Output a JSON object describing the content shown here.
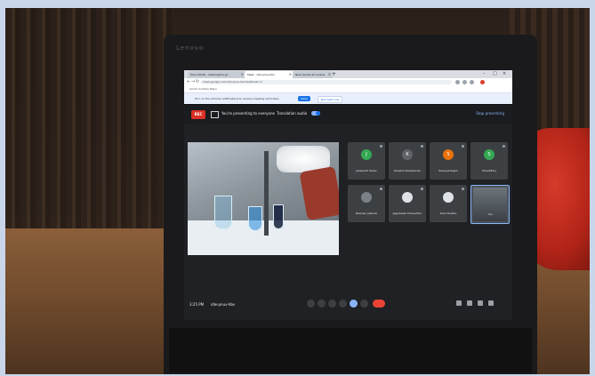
{
  "laptop": {
    "brand": "Lenovo"
  },
  "browser": {
    "tabs": [
      {
        "label": "Plus (2018) - shakira@lcs.gc"
      },
      {
        "label": "Meet - ofw-pnuv-hbv"
      },
      {
        "label": "New results at oceans"
      }
    ],
    "url": "meet.google.com/ofw-pnuv-hbv?authuser=1",
    "bookmarks": "Gmail  YouTube  Maps",
    "notice": {
      "text": "Turn on the Chrome notifications to receive meeting reminders",
      "primary_label": "Allow",
      "secondary_label": "Not right now"
    }
  },
  "meet": {
    "record_label": "REC",
    "presenting_text": "You're presenting to everyone",
    "translation_label": "Translation audio",
    "stop_label": "Stop presenting",
    "time": "3:25 PM",
    "meeting_code": "ofw-pnuv-hbv",
    "participants": [
      {
        "initial": "J",
        "name": "Jaswanth Yadav",
        "color": "#34a853"
      },
      {
        "initial": "K",
        "name": "Kaushal Deshpande",
        "color": "#5f6368"
      },
      {
        "initial": "S",
        "name": "Saranya Rajan",
        "color": "#e8710a"
      },
      {
        "initial": "S",
        "name": "Shraddha J",
        "color": "#34a853"
      },
      {
        "initial": "",
        "name": "Rahman Jalal Ali",
        "color": "#3c4043"
      },
      {
        "initial": "",
        "name": "Jagadeesh Pranavithu",
        "color": "#3c4043"
      },
      {
        "initial": "",
        "name": "Sunil Prabhu",
        "color": "#3c4043"
      },
      {
        "initial": "",
        "name": "You",
        "color": "#4a525a"
      }
    ],
    "accent": "#8ab4f8",
    "end_call_color": "#ea4335"
  }
}
